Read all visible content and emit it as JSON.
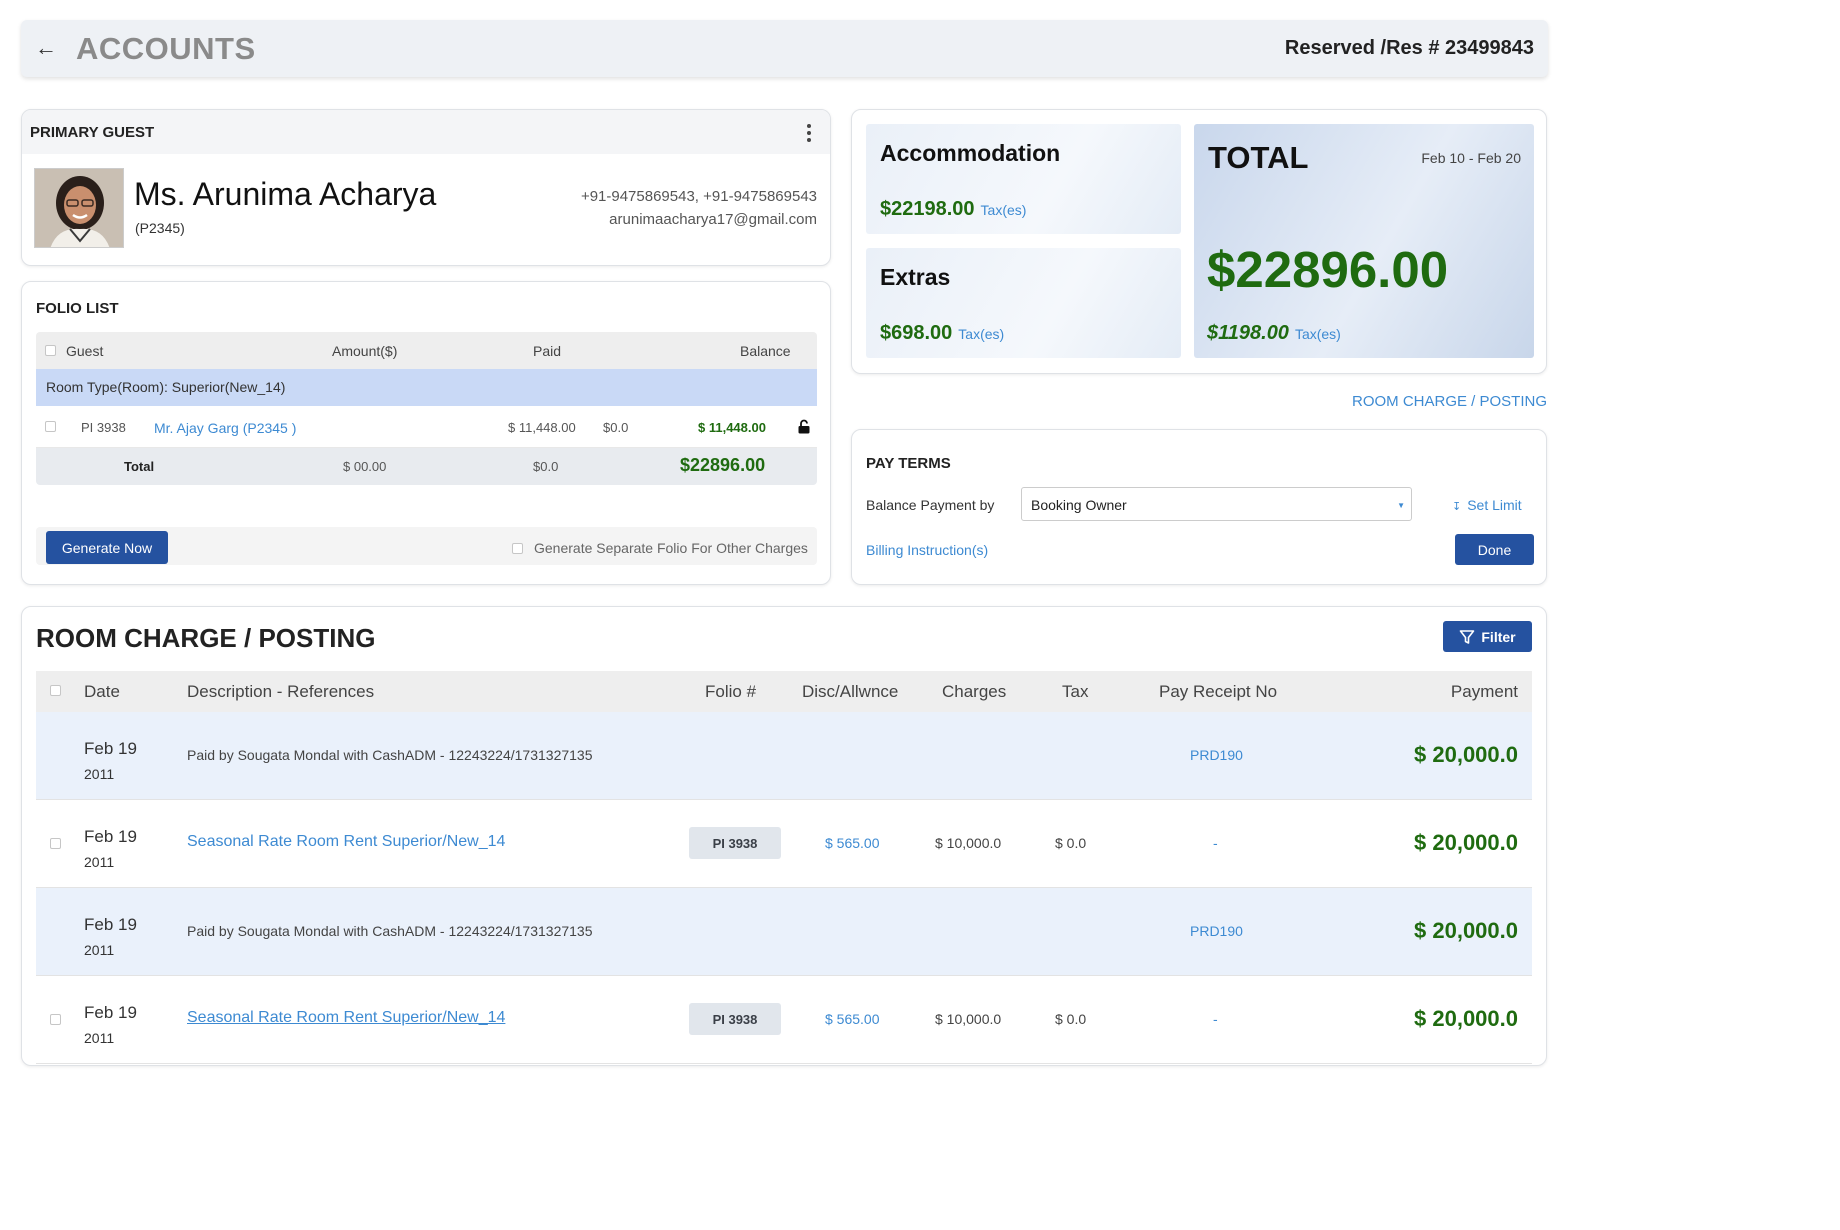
{
  "header": {
    "back_icon": "←",
    "title": "ACCOUNTS",
    "reservation": "Reserved /Res # 23499843"
  },
  "primary_guest": {
    "heading": "PRIMARY GUEST",
    "name": "Ms. Arunima Acharya",
    "id": "(P2345)",
    "phone": "+91-9475869543,  +91-9475869543",
    "email": "arunimaacharya17@gmail.com"
  },
  "folio": {
    "heading": "FOLIO LIST",
    "columns": {
      "guest": "Guest",
      "amount": "Amount($)",
      "paid": "Paid",
      "balance": "Balance"
    },
    "group": "Room Type(Room): Superior(New_14)",
    "item": {
      "folio": "PI 3938",
      "guest": "Mr. Ajay Garg (P2345 )",
      "amount": "$ 11,448.00",
      "paid": "$0.0",
      "balance": "$ 11,448.00"
    },
    "total": {
      "label": "Total",
      "amount": "$ 00.00",
      "paid": "$0.0",
      "balance": "$22896.00"
    },
    "generate_button": "Generate Now",
    "separate_folio_label": "Generate Separate Folio For Other Charges"
  },
  "summary": {
    "accommodation": {
      "label": "Accommodation",
      "amount": "$22198.00",
      "tax": "Tax(es)"
    },
    "extras": {
      "label": "Extras",
      "amount": "$698.00",
      "tax": "Tax(es)"
    },
    "total": {
      "label": "TOTAL",
      "dates": "Feb 10 - Feb 20",
      "amount": "$22896.00",
      "tax_amount": "$1198.00",
      "tax": "Tax(es)"
    }
  },
  "room_charge_link": "ROOM CHARGE / POSTING",
  "pay_terms": {
    "heading": "PAY TERMS",
    "balance_label": "Balance Payment by",
    "balance_value": "Booking Owner",
    "set_limit": "Set Limit",
    "billing_instructions": "Billing Instruction(s)",
    "done_button": "Done"
  },
  "room_charges": {
    "heading": "ROOM CHARGE / POSTING",
    "filter_button": "Filter",
    "columns": {
      "date": "Date",
      "description": "Description - References",
      "folio": "Folio #",
      "disc": "Disc/Allwnce",
      "charges": "Charges",
      "tax": "Tax",
      "receipt": "Pay Receipt No",
      "payment": "Payment"
    },
    "rows": [
      {
        "date": "Feb 19",
        "year": "2011",
        "description": "Paid by Sougata Mondal with CashADM - 12243224/1731327135",
        "receipt": "PRD190",
        "payment": "$ 20,000.0"
      },
      {
        "date": "Feb 19",
        "year": "2011",
        "description": "Seasonal Rate Room Rent Superior/New_14",
        "folio": "PI 3938",
        "disc": "$ 565.00",
        "charges": "$ 10,000.0",
        "tax": "$ 0.0",
        "receipt": "-",
        "payment": "$ 20,000.0"
      },
      {
        "date": "Feb 19",
        "year": "2011",
        "description": "Paid by Sougata Mondal with CashADM - 12243224/1731327135",
        "receipt": "PRD190",
        "payment": "$ 20,000.0"
      },
      {
        "date": "Feb 19",
        "year": "2011",
        "description": "Seasonal Rate Room Rent Superior/New_14",
        "folio": "PI 3938",
        "disc": "$ 565.00",
        "charges": "$ 10,000.0",
        "tax": "$ 0.0",
        "receipt": "-",
        "payment": "$ 20,000.0"
      }
    ]
  }
}
